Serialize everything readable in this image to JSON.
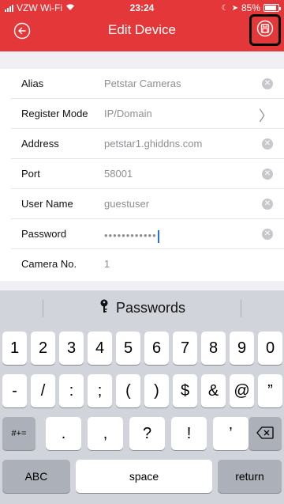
{
  "status": {
    "carrier": "VZW Wi-Fi",
    "time": "23:24",
    "battery": "85%",
    "battery_level": 0.85
  },
  "nav": {
    "title": "Edit Device",
    "back_icon": "circle-arrow-left-icon",
    "save_icon": "save-icon"
  },
  "form": {
    "alias_label": "Alias",
    "alias_value": "Petstar Cameras",
    "register_mode_label": "Register Mode",
    "register_mode_value": "IP/Domain",
    "address_label": "Address",
    "address_value": "petstar1.ghiddns.com",
    "port_label": "Port",
    "port_value": "58001",
    "username_label": "User Name",
    "username_value": "guestuser",
    "password_label": "Password",
    "password_value": "••••••••••••",
    "camera_no_label": "Camera No.",
    "camera_no_value": "1"
  },
  "keyboard": {
    "suggestion": "Passwords",
    "row1": [
      "1",
      "2",
      "3",
      "4",
      "5",
      "6",
      "7",
      "8",
      "9",
      "0"
    ],
    "row2": [
      "-",
      "/",
      ":",
      ";",
      "(",
      ")",
      "$",
      "&",
      "@",
      "”"
    ],
    "row3_left": "#+=",
    "row3": [
      ".",
      ",",
      "?",
      "!",
      "’"
    ],
    "delete_icon": "backspace-icon",
    "abc": "ABC",
    "space": "space",
    "return": "return"
  },
  "colors": {
    "header": "#e4373a",
    "keyboard_bg": "#d1d4da"
  }
}
